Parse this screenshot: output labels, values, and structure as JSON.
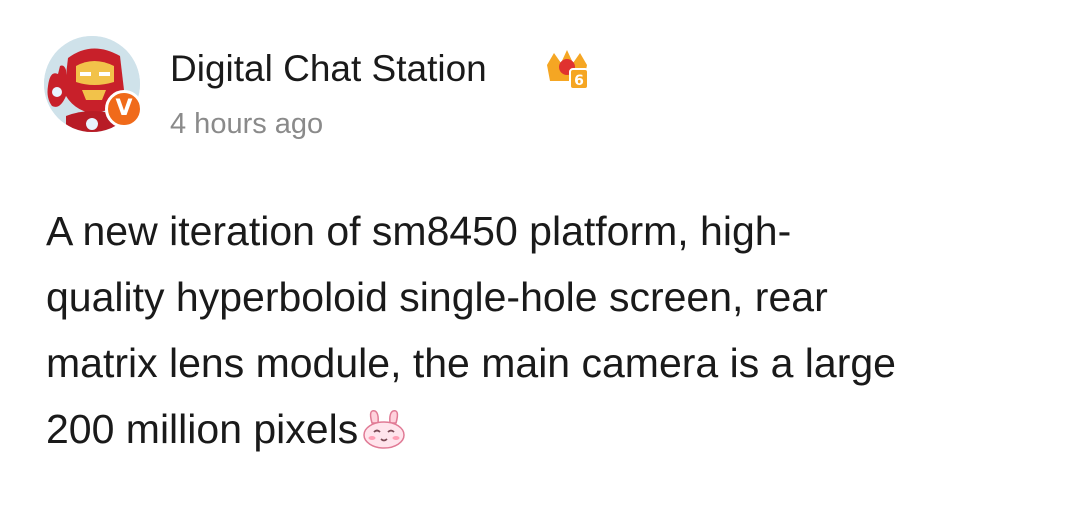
{
  "post": {
    "author": {
      "name": "Digital Chat Station",
      "avatar_icon": "iron-man-avatar",
      "verified_badge_text": "V",
      "verified_color": "#f06a1a",
      "vip_badge_icon": "crown-level-badge",
      "vip_badge_level": "6"
    },
    "timestamp": "4 hours ago",
    "content_lines": [
      "A new iteration of sm8450 platform, high-",
      "quality hyperboloid single-hole screen, rear",
      "matrix lens module, the main camera is a large",
      "200 million pixels"
    ],
    "content_emoji": "bunny-smile-emoji"
  }
}
